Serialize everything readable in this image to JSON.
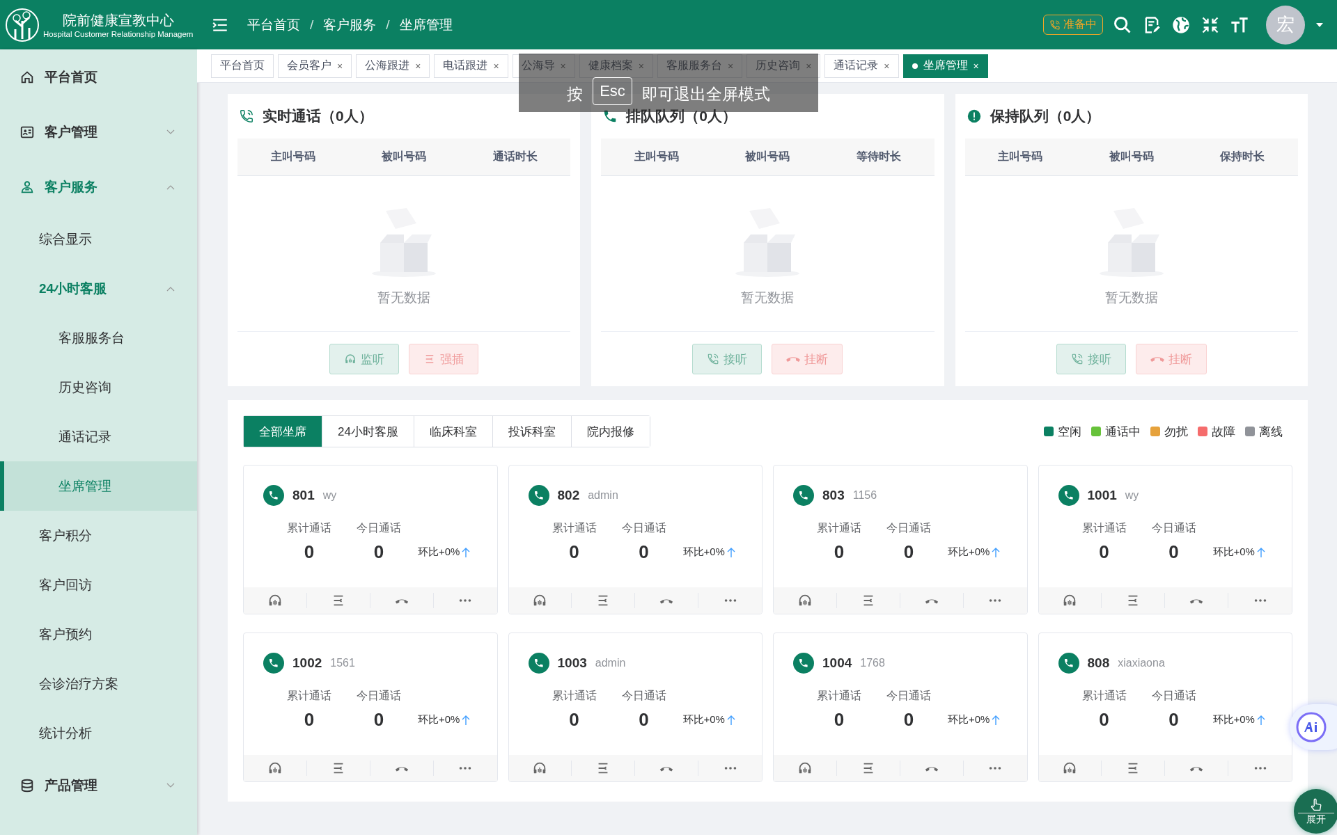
{
  "header": {
    "title": "院前健康宣教中心",
    "subtitle": "Hospital Customer Relationship Managem",
    "breadcrumb": [
      "平台首页",
      "/",
      "客户服务",
      "/",
      "坐席管理"
    ],
    "status": "准备中",
    "avatar": "宏"
  },
  "sidebar": {
    "items": [
      {
        "label": "平台首页",
        "selected": false
      },
      {
        "label": "客户管理",
        "expanded": false,
        "selected": false
      },
      {
        "label": "客户服务",
        "expanded": true,
        "selected": false,
        "children": [
          {
            "label": "综合显示",
            "selected": false
          },
          {
            "label": "24小时客服",
            "expanded": true,
            "selected": false,
            "children": [
              {
                "label": "客服服务台",
                "selected": false
              },
              {
                "label": "历史咨询",
                "selected": false
              },
              {
                "label": "通话记录",
                "selected": false
              },
              {
                "label": "坐席管理",
                "selected": true
              }
            ]
          },
          {
            "label": "客户积分",
            "selected": false
          },
          {
            "label": "客户回访",
            "selected": false
          },
          {
            "label": "客户预约",
            "selected": false
          },
          {
            "label": "会诊治疗方案",
            "selected": false
          },
          {
            "label": "统计分析",
            "selected": false
          }
        ]
      },
      {
        "label": "产品管理",
        "expanded": false,
        "selected": false
      }
    ]
  },
  "tabs": [
    {
      "label": "平台首页",
      "selected": false
    },
    {
      "label": "会员客户",
      "close": "×",
      "selected": false
    },
    {
      "label": "公海跟进",
      "close": "×",
      "selected": false
    },
    {
      "label": "电话跟进",
      "close": "×",
      "selected": false
    },
    {
      "label": "公海导",
      "close": "×",
      "selected": false
    },
    {
      "label": "健康档案",
      "close": "×",
      "selected": false
    },
    {
      "label": "客服服务台",
      "close": "×",
      "selected": false
    },
    {
      "label": "历史咨询",
      "close": "×",
      "selected": false
    },
    {
      "label": "通话记录",
      "close": "×",
      "selected": false
    },
    {
      "label": "坐席管理",
      "close": "×",
      "selected": true
    }
  ],
  "fullscreen_hint": {
    "before": "按",
    "key": "Esc",
    "after": "即可退出全屏模式"
  },
  "queues": [
    {
      "title": "实时通话（0人）",
      "columns": [
        "主叫号码",
        "被叫号码",
        "通话时长"
      ],
      "empty": "暂无数据",
      "buttons": [
        {
          "label": "监听",
          "kind": "listen"
        },
        {
          "label": "强插",
          "kind": "barge"
        }
      ]
    },
    {
      "title": "排队队列（0人）",
      "columns": [
        "主叫号码",
        "被叫号码",
        "等待时长"
      ],
      "empty": "暂无数据",
      "buttons": [
        {
          "label": "接听",
          "kind": "answer"
        },
        {
          "label": "挂断",
          "kind": "hangup"
        }
      ]
    },
    {
      "title": "保持队列（0人）",
      "columns": [
        "主叫号码",
        "被叫号码",
        "保持时长"
      ],
      "empty": "暂无数据",
      "buttons": [
        {
          "label": "接听",
          "kind": "answer"
        },
        {
          "label": "挂断",
          "kind": "hangup"
        }
      ]
    }
  ],
  "agent_filters": [
    {
      "label": "全部坐席",
      "selected": true
    },
    {
      "label": "24小时客服",
      "selected": false
    },
    {
      "label": "临床科室",
      "selected": false
    },
    {
      "label": "投诉科室",
      "selected": false
    },
    {
      "label": "院内报修",
      "selected": false
    }
  ],
  "legend": [
    {
      "label": "空闲",
      "color": "#0b8062"
    },
    {
      "label": "通话中",
      "color": "#67c23a"
    },
    {
      "label": "勿扰",
      "color": "#e6a23c"
    },
    {
      "label": "故障",
      "color": "#f56c6c"
    },
    {
      "label": "离线",
      "color": "#909399"
    }
  ],
  "agents": [
    {
      "ext": "801",
      "user": "wy",
      "total_label": "累计通话",
      "today_label": "今日通话",
      "total": "0",
      "today": "0",
      "ratio": "环比+0%"
    },
    {
      "ext": "802",
      "user": "admin",
      "total_label": "累计通话",
      "today_label": "今日通话",
      "total": "0",
      "today": "0",
      "ratio": "环比+0%"
    },
    {
      "ext": "803",
      "user": "1156",
      "total_label": "累计通话",
      "today_label": "今日通话",
      "total": "0",
      "today": "0",
      "ratio": "环比+0%"
    },
    {
      "ext": "1001",
      "user": "wy",
      "total_label": "累计通话",
      "today_label": "今日通话",
      "total": "0",
      "today": "0",
      "ratio": "环比+0%"
    },
    {
      "ext": "1002",
      "user": "1561",
      "total_label": "累计通话",
      "today_label": "今日通话",
      "total": "0",
      "today": "0",
      "ratio": "环比+0%"
    },
    {
      "ext": "1003",
      "user": "admin",
      "total_label": "累计通话",
      "today_label": "今日通话",
      "total": "0",
      "today": "0",
      "ratio": "环比+0%"
    },
    {
      "ext": "1004",
      "user": "1768",
      "total_label": "累计通话",
      "today_label": "今日通话",
      "total": "0",
      "today": "0",
      "ratio": "环比+0%"
    },
    {
      "ext": "808",
      "user": "xiaxiaona",
      "total_label": "累计通话",
      "today_label": "今日通话",
      "total": "0",
      "today": "0",
      "ratio": "环比+0%"
    }
  ],
  "float": {
    "expand": "展开"
  }
}
